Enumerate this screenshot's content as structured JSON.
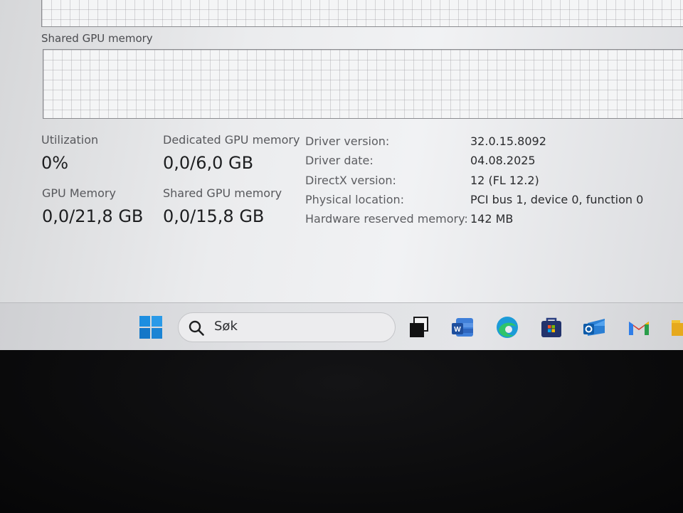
{
  "graphs": {
    "shared_label": "Shared GPU memory"
  },
  "stats": {
    "utilization": {
      "label": "Utilization",
      "value": "0%"
    },
    "dedicated": {
      "label": "Dedicated GPU memory",
      "value": "0,0/6,0 GB"
    },
    "gpu_memory": {
      "label": "GPU Memory",
      "value": "0,0/21,8 GB"
    },
    "shared": {
      "label": "Shared GPU memory",
      "value": "0,0/15,8 GB"
    }
  },
  "info": [
    {
      "key": "Driver version:",
      "value": "32.0.15.8092"
    },
    {
      "key": "Driver date:",
      "value": "04.08.2025"
    },
    {
      "key": "DirectX version:",
      "value": "12 (FL 12.2)"
    },
    {
      "key": "Physical location:",
      "value": "PCI bus 1, device 0, function 0"
    },
    {
      "key": "Hardware reserved memory:",
      "value": "142 MB"
    }
  ],
  "taskbar": {
    "search_placeholder": "Søk",
    "icons": [
      "windows-start-icon",
      "task-view-icon",
      "word-icon",
      "edge-icon",
      "microsoft-store-icon",
      "outlook-icon",
      "gmail-icon",
      "file-explorer-icon"
    ],
    "colors": {
      "windows": "#1a86d6",
      "word": "#2b5ab0",
      "edge": "#1a9ad6",
      "store": "#2a3e80",
      "outlook": "#1a73c8",
      "gmail_red": "#d93a2d"
    }
  }
}
